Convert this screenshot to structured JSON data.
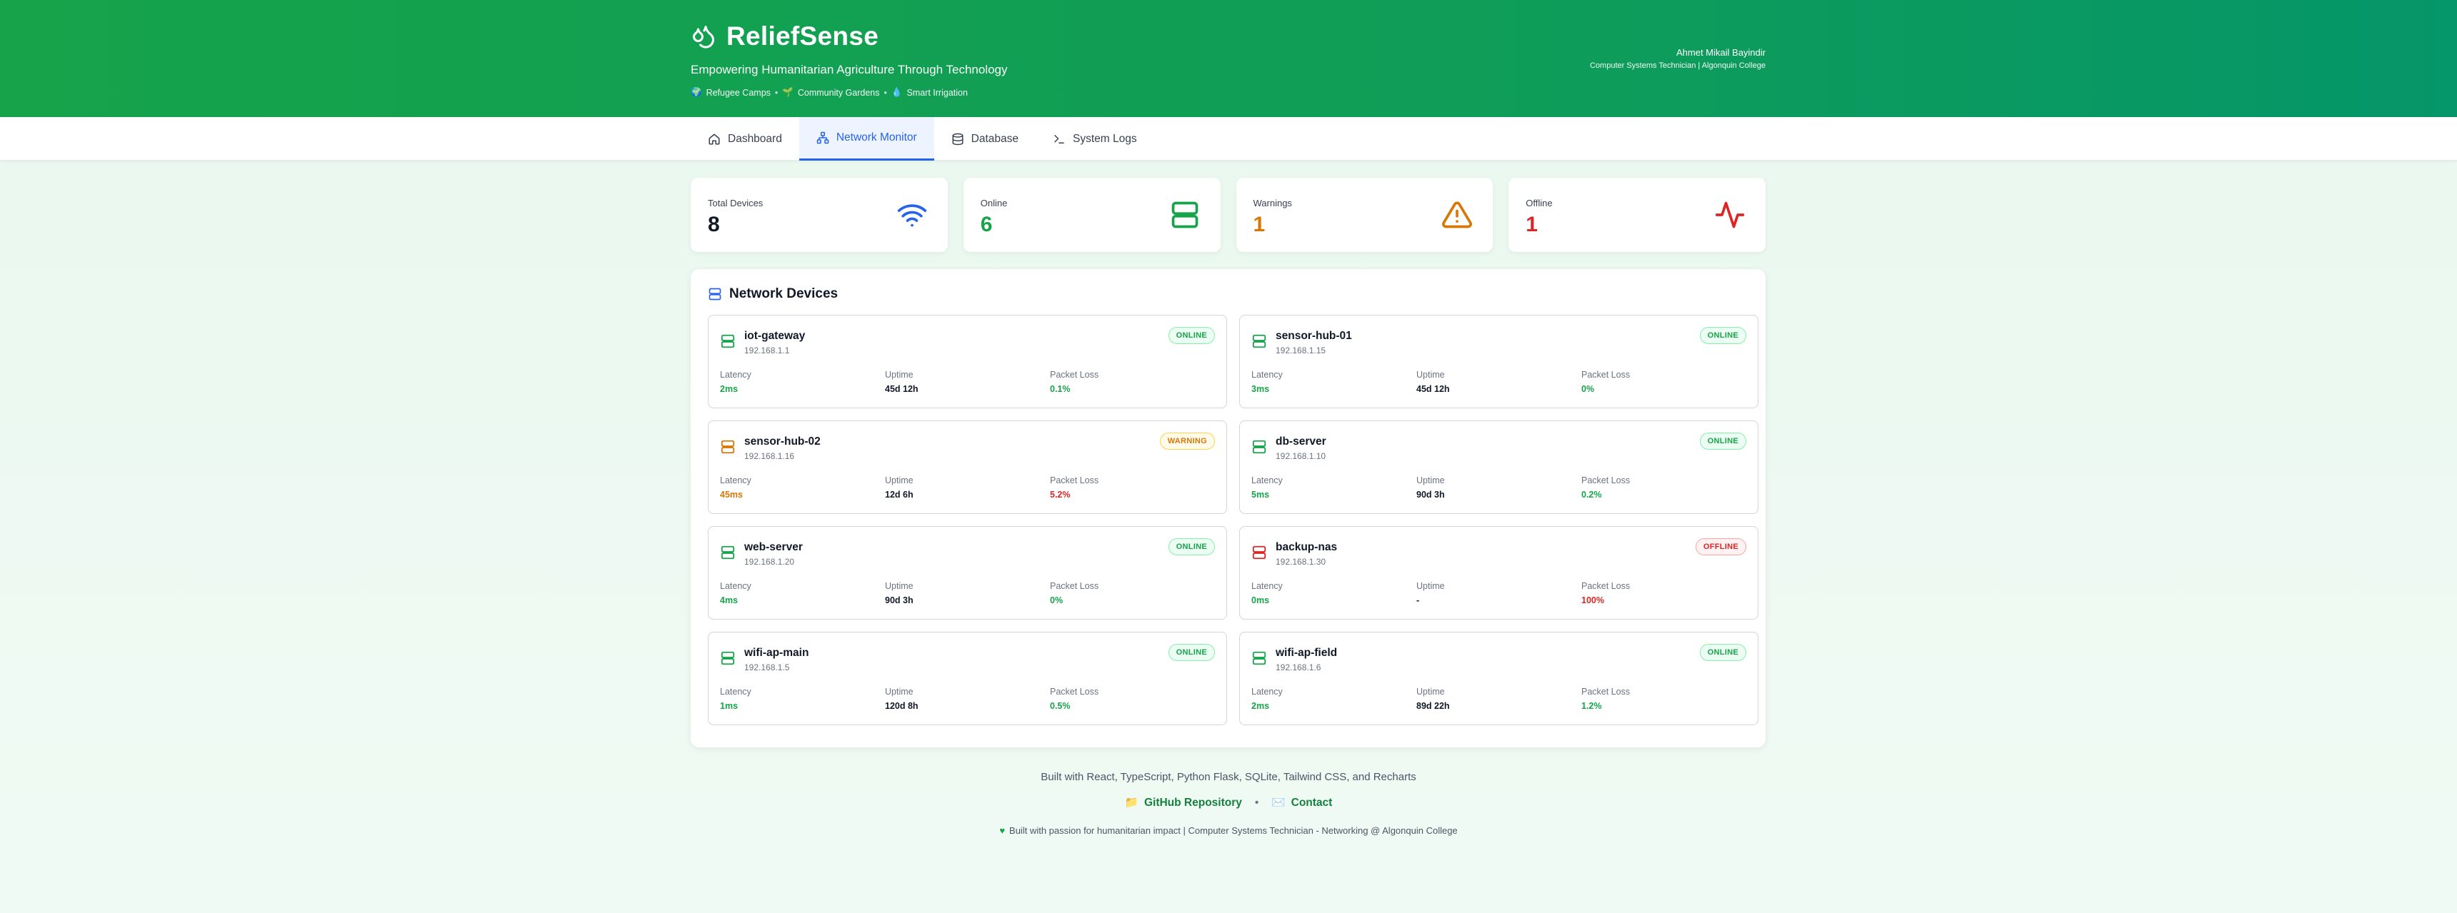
{
  "header": {
    "title": "ReliefSense",
    "tagline": "Empowering Humanitarian Agriculture Through Technology",
    "subtags": [
      "Refugee Camps",
      "Community Gardens",
      "Smart Irrigation"
    ],
    "author_name": "Ahmet Mikail Bayindir",
    "author_role": "Computer Systems Technician | Algonquin College"
  },
  "nav": {
    "tabs": [
      {
        "label": "Dashboard",
        "icon": "home-icon"
      },
      {
        "label": "Network Monitor",
        "icon": "network-icon",
        "active": true
      },
      {
        "label": "Database",
        "icon": "database-icon"
      },
      {
        "label": "System Logs",
        "icon": "terminal-icon"
      }
    ]
  },
  "stats": [
    {
      "label": "Total Devices",
      "value": "8",
      "icon": "wifi-icon",
      "color": "#111827"
    },
    {
      "label": "Online",
      "value": "6",
      "icon": "server-icon",
      "color": "#16a34a"
    },
    {
      "label": "Warnings",
      "value": "1",
      "icon": "warning-triangle-icon",
      "color": "#d97706"
    },
    {
      "label": "Offline",
      "value": "1",
      "icon": "activity-icon",
      "color": "#dc2626"
    }
  ],
  "devices_panel": {
    "title": "Network Devices",
    "metric_labels": {
      "latency": "Latency",
      "uptime": "Uptime",
      "packet_loss": "Packet Loss"
    },
    "devices": [
      {
        "name": "iot-gateway",
        "ip": "192.168.1.1",
        "status": "ONLINE",
        "latency": "2ms",
        "uptime": "45d 12h",
        "packet_loss": "0.1%"
      },
      {
        "name": "sensor-hub-01",
        "ip": "192.168.1.15",
        "status": "ONLINE",
        "latency": "3ms",
        "uptime": "45d 12h",
        "packet_loss": "0%"
      },
      {
        "name": "sensor-hub-02",
        "ip": "192.168.1.16",
        "status": "WARNING",
        "latency": "45ms",
        "uptime": "12d 6h",
        "packet_loss": "5.2%"
      },
      {
        "name": "db-server",
        "ip": "192.168.1.10",
        "status": "ONLINE",
        "latency": "5ms",
        "uptime": "90d 3h",
        "packet_loss": "0.2%"
      },
      {
        "name": "web-server",
        "ip": "192.168.1.20",
        "status": "ONLINE",
        "latency": "4ms",
        "uptime": "90d 3h",
        "packet_loss": "0%"
      },
      {
        "name": "backup-nas",
        "ip": "192.168.1.30",
        "status": "OFFLINE",
        "latency": "0ms",
        "uptime": "-",
        "packet_loss": "100%"
      },
      {
        "name": "wifi-ap-main",
        "ip": "192.168.1.5",
        "status": "ONLINE",
        "latency": "1ms",
        "uptime": "120d 8h",
        "packet_loss": "0.5%"
      },
      {
        "name": "wifi-ap-field",
        "ip": "192.168.1.6",
        "status": "ONLINE",
        "latency": "2ms",
        "uptime": "89d 22h",
        "packet_loss": "1.2%"
      }
    ]
  },
  "footer": {
    "built_with": "Built with React, TypeScript, Python Flask, SQLite, Tailwind CSS, and Recharts",
    "github_label": "GitHub Repository",
    "contact_label": "Contact",
    "separator": "•",
    "passion": "Built with passion for humanitarian impact | Computer Systems Technician - Networking @ Algonquin College"
  },
  "colors": {
    "header_green": "#16a34a",
    "accent_blue": "#2563eb",
    "online": "#16a34a",
    "warning": "#d97706",
    "offline": "#dc2626"
  }
}
